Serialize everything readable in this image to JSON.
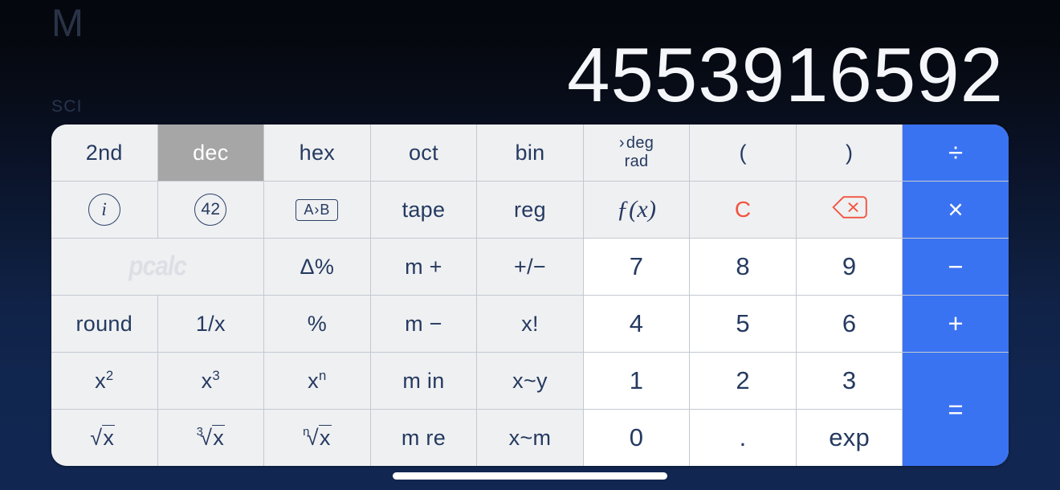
{
  "app": {
    "name": "PCalc",
    "brand_wordmark": "pcalc",
    "background_top_color": "#05080f",
    "background_bottom_color": "#112650",
    "accent_operator_color": "#3a73f2",
    "key_text_color": "#253a60",
    "destructive_color": "#f1543f",
    "active_key_color": "#a6a6a6"
  },
  "display": {
    "memory_indicator": "M",
    "mode_indicator": "SCI",
    "value": "4553916592"
  },
  "keypad": {
    "rows": [
      [
        {
          "id": "2nd",
          "label": "2nd",
          "type": "func",
          "state": "normal"
        },
        {
          "id": "dec",
          "label": "dec",
          "type": "func",
          "state": "active"
        },
        {
          "id": "hex",
          "label": "hex",
          "type": "func",
          "state": "normal"
        },
        {
          "id": "oct",
          "label": "oct",
          "type": "func",
          "state": "normal"
        },
        {
          "id": "bin",
          "label": "bin",
          "type": "func",
          "state": "normal"
        },
        {
          "id": "degrad",
          "label": "deg / rad",
          "deg": "deg",
          "rad": "rad",
          "chevron": "›",
          "selected": "deg",
          "type": "func",
          "state": "normal"
        },
        {
          "id": "paren-open",
          "label": "(",
          "type": "func",
          "state": "normal"
        },
        {
          "id": "paren-close",
          "label": ")",
          "type": "func",
          "state": "normal"
        },
        {
          "id": "divide",
          "label": "÷",
          "type": "operator",
          "state": "normal"
        }
      ],
      [
        {
          "id": "info",
          "label": "i",
          "type": "func",
          "state": "normal",
          "icon": "circled-info-icon"
        },
        {
          "id": "constants",
          "label": "42",
          "type": "func",
          "state": "normal",
          "icon": "circled-constants-icon"
        },
        {
          "id": "convert",
          "label": "A › B",
          "a": "A",
          "b": "B",
          "chevron": "›",
          "type": "func",
          "state": "normal",
          "icon": "unit-convert-icon"
        },
        {
          "id": "tape",
          "label": "tape",
          "type": "func",
          "state": "normal"
        },
        {
          "id": "reg",
          "label": "reg",
          "type": "func",
          "state": "normal"
        },
        {
          "id": "fx",
          "label": "ƒ(x)",
          "type": "func",
          "state": "normal"
        },
        {
          "id": "clear",
          "label": "C",
          "type": "func",
          "state": "destructive"
        },
        {
          "id": "backspace",
          "label": "backspace",
          "type": "func",
          "state": "destructive",
          "icon": "backspace-icon"
        },
        {
          "id": "multiply",
          "label": "×",
          "type": "operator",
          "state": "normal"
        }
      ],
      [
        {
          "id": "brand",
          "label": "pcalc",
          "type": "brand",
          "state": "normal",
          "span": 2
        },
        {
          "id": "delta-pct",
          "label": "Δ%",
          "type": "func",
          "state": "normal"
        },
        {
          "id": "mem-plus",
          "label": "m +",
          "type": "func",
          "state": "normal"
        },
        {
          "id": "sign",
          "label": "+/−",
          "type": "func",
          "state": "normal"
        },
        {
          "id": "seven",
          "label": "7",
          "type": "number",
          "state": "normal"
        },
        {
          "id": "eight",
          "label": "8",
          "type": "number",
          "state": "normal"
        },
        {
          "id": "nine",
          "label": "9",
          "type": "number",
          "state": "normal"
        },
        {
          "id": "minus",
          "label": "−",
          "type": "operator",
          "state": "normal"
        }
      ],
      [
        {
          "id": "round",
          "label": "round",
          "type": "func",
          "state": "normal"
        },
        {
          "id": "reciprocal",
          "label": "1/x",
          "type": "func",
          "state": "normal"
        },
        {
          "id": "percent",
          "label": "%",
          "type": "func",
          "state": "normal"
        },
        {
          "id": "mem-minus",
          "label": "m −",
          "type": "func",
          "state": "normal"
        },
        {
          "id": "factorial",
          "label": "x!",
          "type": "func",
          "state": "normal"
        },
        {
          "id": "four",
          "label": "4",
          "type": "number",
          "state": "normal"
        },
        {
          "id": "five",
          "label": "5",
          "type": "number",
          "state": "normal"
        },
        {
          "id": "six",
          "label": "6",
          "type": "number",
          "state": "normal"
        },
        {
          "id": "plus",
          "label": "+",
          "type": "operator",
          "state": "normal"
        }
      ],
      [
        {
          "id": "square",
          "label": "x2",
          "base": "x",
          "exp": "2",
          "type": "func",
          "state": "normal"
        },
        {
          "id": "cube",
          "label": "x3",
          "base": "x",
          "exp": "3",
          "type": "func",
          "state": "normal"
        },
        {
          "id": "power-n",
          "label": "xn",
          "base": "x",
          "exp": "n",
          "type": "func",
          "state": "normal"
        },
        {
          "id": "mem-in",
          "label": "m in",
          "type": "func",
          "state": "normal"
        },
        {
          "id": "swap-xy",
          "label": "x~y",
          "type": "func",
          "state": "normal"
        },
        {
          "id": "one",
          "label": "1",
          "type": "number",
          "state": "normal"
        },
        {
          "id": "two",
          "label": "2",
          "type": "number",
          "state": "normal"
        },
        {
          "id": "three",
          "label": "3",
          "type": "number",
          "state": "normal"
        },
        {
          "id": "equals",
          "label": "=",
          "type": "operator",
          "state": "normal",
          "rowspan": 2
        }
      ],
      [
        {
          "id": "sqrt",
          "label": "√x",
          "index": "",
          "radicand": "x",
          "type": "func",
          "state": "normal"
        },
        {
          "id": "cbrt",
          "label": "3√x",
          "index": "3",
          "radicand": "x",
          "type": "func",
          "state": "normal"
        },
        {
          "id": "nthroot",
          "label": "n√x",
          "index": "n",
          "radicand": "x",
          "type": "func",
          "state": "normal"
        },
        {
          "id": "mem-re",
          "label": "m re",
          "type": "func",
          "state": "normal"
        },
        {
          "id": "swap-xm",
          "label": "x~m",
          "type": "func",
          "state": "normal"
        },
        {
          "id": "zero",
          "label": "0",
          "type": "number",
          "state": "normal"
        },
        {
          "id": "decimal",
          "label": ".",
          "type": "number",
          "state": "normal"
        },
        {
          "id": "exp",
          "label": "exp",
          "type": "number",
          "state": "normal"
        }
      ]
    ]
  },
  "system": {
    "home_indicator": "home-indicator"
  }
}
